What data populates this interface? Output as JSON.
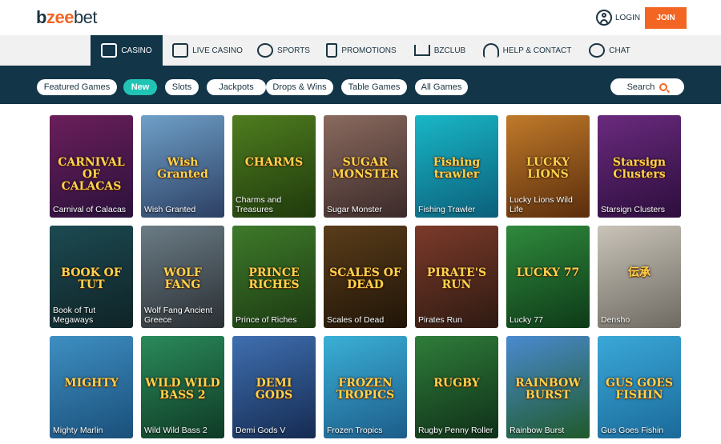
{
  "brand": {
    "b": "b",
    "z": "zee",
    "bet": "bet"
  },
  "header": {
    "login_label": "LOGIN",
    "join_label": "JOIN"
  },
  "nav": [
    {
      "label": "CASINO",
      "icon": "slot-machine-icon",
      "active": true
    },
    {
      "label": "LIVE CASINO",
      "icon": "camera-icon"
    },
    {
      "label": "SPORTS",
      "icon": "soccer-ball-icon"
    },
    {
      "label": "PROMOTIONS",
      "icon": "gift-bag-icon"
    },
    {
      "label": "BZCLUB",
      "icon": "crown-icon"
    },
    {
      "label": "HELP & CONTACT",
      "icon": "headset-icon"
    },
    {
      "label": "CHAT",
      "icon": "chat-bubble-icon"
    }
  ],
  "filters": [
    {
      "label": "Featured Games"
    },
    {
      "label": "New",
      "active": true
    },
    {
      "label": "Slots"
    },
    {
      "label": "Jackpots"
    },
    {
      "label": "Drops & Wins"
    },
    {
      "label": "Table Games"
    },
    {
      "label": "All Games"
    }
  ],
  "search": {
    "label": "Search"
  },
  "colors": {
    "brand_dark": "#123547",
    "accent_orange": "#f26522",
    "active_pill": "#20c4b5"
  },
  "games": [
    {
      "name": "Carnival of Calacas",
      "art_text": "CARNIVAL OF CALACAS",
      "colors": [
        "#6b1e5a",
        "#2b123d"
      ]
    },
    {
      "name": "Wish Granted",
      "art_text": "Wish Granted",
      "colors": [
        "#6fa0c8",
        "#2c3f63"
      ]
    },
    {
      "name": "Charms and Treasures",
      "art_text": "CHARMS",
      "colors": [
        "#4f7d1f",
        "#1f3a0c"
      ]
    },
    {
      "name": "Sugar Monster",
      "art_text": "SUGAR MONSTER",
      "colors": [
        "#8a6a5e",
        "#3b2a2a"
      ]
    },
    {
      "name": "Fishing Trawler",
      "art_text": "Fishing trawler",
      "colors": [
        "#19b7c7",
        "#0b5f7a"
      ]
    },
    {
      "name": "Lucky Lions Wild Life",
      "art_text": "LUCKY LIONS",
      "colors": [
        "#c07a2a",
        "#5a2d0c"
      ]
    },
    {
      "name": "Starsign Clusters",
      "art_text": "Starsign Clusters",
      "colors": [
        "#6a2a7e",
        "#2d0e3d"
      ]
    },
    {
      "name": "Book of Tut Megaways",
      "art_text": "BOOK OF TUT",
      "colors": [
        "#1c4a52",
        "#0f2326"
      ]
    },
    {
      "name": "Wolf Fang Ancient Greece",
      "art_text": "WOLF FANG",
      "colors": [
        "#6b7c86",
        "#2a2f33"
      ]
    },
    {
      "name": "Prince of Riches",
      "art_text": "PRINCE RICHES",
      "colors": [
        "#3e7a2a",
        "#1c3a12"
      ]
    },
    {
      "name": "Scales of Dead",
      "art_text": "SCALES OF DEAD",
      "colors": [
        "#5a3d1a",
        "#201408"
      ]
    },
    {
      "name": "Pirates Run",
      "art_text": "PIRATE'S RUN",
      "colors": [
        "#7c3a2a",
        "#2e1a12"
      ]
    },
    {
      "name": "Lucky 77",
      "art_text": "LUCKY 77",
      "colors": [
        "#2f8a3c",
        "#0e3a18"
      ]
    },
    {
      "name": "Densho",
      "art_text": "伝承",
      "colors": [
        "#c9c3b8",
        "#6e6a62"
      ]
    },
    {
      "name": "Mighty Marlin",
      "art_text": "MIGHTY",
      "colors": [
        "#3e8fc2",
        "#1a4f7a"
      ]
    },
    {
      "name": "Wild Wild Bass 2",
      "art_text": "WILD WILD BASS 2",
      "colors": [
        "#2a8a5a",
        "#0f3a26"
      ]
    },
    {
      "name": "Demi Gods V",
      "art_text": "DEMI GODS",
      "colors": [
        "#3f6fb0",
        "#152b52"
      ]
    },
    {
      "name": "Frozen Tropics",
      "art_text": "FROZEN TROPICS",
      "colors": [
        "#3ab0d6",
        "#1d5c8a"
      ]
    },
    {
      "name": "Rugby Penny Roller",
      "art_text": "RUGBY",
      "colors": [
        "#2f7d3a",
        "#0f2f18"
      ]
    },
    {
      "name": "Rainbow Burst",
      "art_text": "RAINBOW BURST",
      "colors": [
        "#4a8ad0",
        "#1f5a2a"
      ]
    },
    {
      "name": "Gus Goes Fishin",
      "art_text": "GUS GOES FISHIN",
      "colors": [
        "#3aa8d8",
        "#1a6a9a"
      ]
    }
  ]
}
